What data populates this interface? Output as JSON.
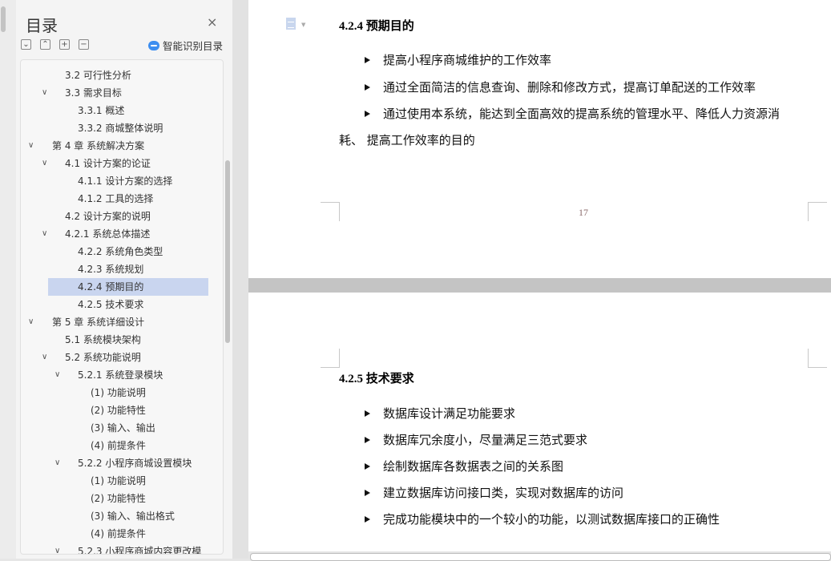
{
  "toc_panel": {
    "title": "目录",
    "close": "×",
    "buttons": {
      "expand": "⌄",
      "collapse": "⌃",
      "add": "+",
      "remove": "−"
    },
    "smart_label": "智能识别目录",
    "items": [
      {
        "label": "3.2  可行性分析",
        "level": 1,
        "chevron": false
      },
      {
        "label": "3.3  需求目标",
        "level": 1,
        "chevron": true
      },
      {
        "label": "3.3.1  概述",
        "level": 2,
        "chevron": false
      },
      {
        "label": "3.3.2  商城整体说明",
        "level": 2,
        "chevron": false
      },
      {
        "label": "第 4 章  系统解决方案",
        "level": 0,
        "chevron": true
      },
      {
        "label": "4.1  设计方案的论证",
        "level": 1,
        "chevron": true
      },
      {
        "label": "4.1.1  设计方案的选择",
        "level": 2,
        "chevron": false
      },
      {
        "label": "4.1.2  工具的选择",
        "level": 2,
        "chevron": false
      },
      {
        "label": "4.2  设计方案的说明",
        "level": 1,
        "chevron": false
      },
      {
        "label": "4.2.1  系统总体描述",
        "level": 1,
        "chevron": true
      },
      {
        "label": "4.2.2  系统角色类型",
        "level": 2,
        "chevron": false
      },
      {
        "label": "4.2.3  系统规划",
        "level": 2,
        "chevron": false
      },
      {
        "label": "4.2.4  预期目的",
        "level": 2,
        "chevron": false,
        "selected": true
      },
      {
        "label": "4.2.5  技术要求",
        "level": 2,
        "chevron": false
      },
      {
        "label": "第 5 章  系统详细设计",
        "level": 0,
        "chevron": true
      },
      {
        "label": "5.1  系统模块架构",
        "level": 1,
        "chevron": false
      },
      {
        "label": "5.2  系统功能说明",
        "level": 1,
        "chevron": true
      },
      {
        "label": "5.2.1  系统登录模块",
        "level": 2,
        "chevron": true
      },
      {
        "label": "(1)  功能说明",
        "level": 3,
        "chevron": false
      },
      {
        "label": "(2)  功能特性",
        "level": 3,
        "chevron": false
      },
      {
        "label": "(3)  输入、输出",
        "level": 3,
        "chevron": false
      },
      {
        "label": "(4)  前提条件",
        "level": 3,
        "chevron": false
      },
      {
        "label": "5.2.2  小程序商城设置模块",
        "level": 2,
        "chevron": true
      },
      {
        "label": "(1)  功能说明",
        "level": 3,
        "chevron": false
      },
      {
        "label": "(2)  功能特性",
        "level": 3,
        "chevron": false
      },
      {
        "label": "(3)  输入、输出格式",
        "level": 3,
        "chevron": false
      },
      {
        "label": "(4)  前提条件",
        "level": 3,
        "chevron": false
      },
      {
        "label": "5.2.3  小程序商城内容更改模",
        "level": 2,
        "chevron": true
      }
    ]
  },
  "document": {
    "page1": {
      "heading": "4.2.4  预期目的",
      "bullets": [
        "提高小程序商城维护的工作效率",
        "通过全面简洁的信息查询、删除和修改方式，提高订单配送的工作效率",
        "通过使用本系统，能达到全面高效的提高系统的管理水平、降低人力资源消"
      ],
      "continuation": "耗、 提高工作效率的目的",
      "page_number": "17"
    },
    "page2": {
      "heading": "4.2.5  技术要求",
      "bullets": [
        "数据库设计满足功能要求",
        "数据库冗余度小，尽量满足三范式要求",
        "绘制数据库各数据表之间的关系图",
        "建立数据库访问接口类，实现对数据库的访问",
        "完成功能模块中的一个较小的功能，以测试数据库接口的正确性"
      ]
    }
  }
}
